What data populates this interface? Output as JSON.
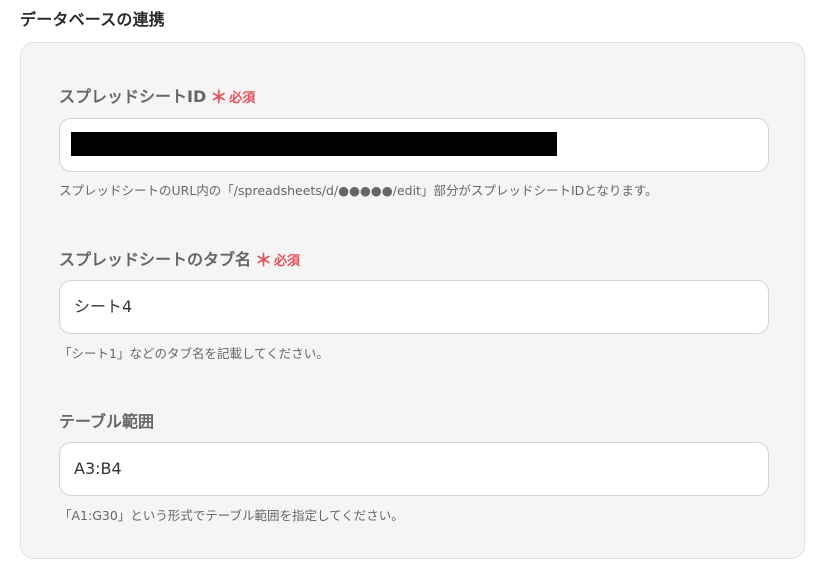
{
  "section": {
    "title": "データベースの連携"
  },
  "fields": {
    "spreadsheet_id": {
      "label": "スプレッドシートID",
      "required_mark": "＊",
      "required_text": "必須",
      "value": "",
      "help": "スプレッドシートのURL内の「/spreadsheets/d/●●●●●/edit」部分がスプレッドシートIDとなります。"
    },
    "tab_name": {
      "label": "スプレッドシートのタブ名",
      "required_mark": "＊",
      "required_text": "必須",
      "value": "シート4",
      "help": "「シート1」などのタブ名を記載してください。"
    },
    "table_range": {
      "label": "テーブル範囲",
      "value": "A3:B4",
      "help": "「A1:G30」という形式でテーブル範囲を指定してください。"
    }
  },
  "colors": {
    "required": "#e0535c",
    "panel_background": "#f5f5f5",
    "label": "#666666"
  }
}
